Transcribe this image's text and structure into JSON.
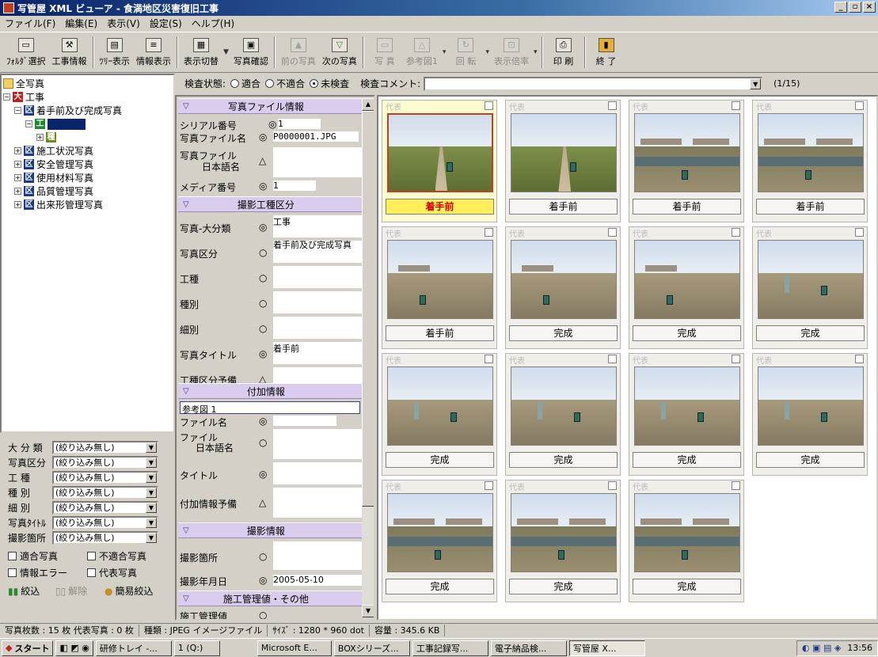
{
  "window": {
    "title": "写管屋 XML ビューア - 食満地区災害復旧工事",
    "min": "_",
    "max": "▫",
    "close": "×"
  },
  "menu": [
    "ファイル(F)",
    "編集(E)",
    "表示(V)",
    "設定(S)",
    "ヘルプ(H)"
  ],
  "toolbar": {
    "folder": "ﾌｫﾙﾀﾞ選択",
    "project": "工事情報",
    "tree": "ﾂﾘｰ表示",
    "info": "情報表示",
    "switch": "表示切替",
    "confirm": "写真確認",
    "prev": "前の写真",
    "next": "次の写真",
    "photo": "写 真",
    "ref": "参考図1",
    "rotate": "回 転",
    "zoom": "表示倍率",
    "print": "印 刷",
    "exit": "終 了"
  },
  "tree": {
    "root": "全写真",
    "project": "工事",
    "section1": "着手前及び完成写真",
    "section1_sub": "工",
    "items": [
      "施工状況写真",
      "安全管理写真",
      "使用材料写真",
      "品質管理写真",
      "出来形管理写真"
    ]
  },
  "filters": {
    "rows": [
      {
        "label": "大 分 類",
        "value": "(絞り込み無し)"
      },
      {
        "label": "写真区分",
        "value": "(絞り込み無し)"
      },
      {
        "label": "工   種",
        "value": "(絞り込み無し)"
      },
      {
        "label": "種   別",
        "value": "(絞り込み無し)"
      },
      {
        "label": "細   別",
        "value": "(絞り込み無し)"
      },
      {
        "label": "写真ﾀｲﾄﾙ",
        "value": "(絞り込み無し)"
      },
      {
        "label": "撮影箇所",
        "value": "(絞り込み無し)"
      }
    ],
    "ok_photo": "適合写真",
    "ng_photo": "不適合写真",
    "info_error": "情報エラー",
    "rep_photo": "代表写真",
    "narrow": "絞込",
    "release": "解除",
    "simple": "簡易絞込"
  },
  "search": {
    "label": "検査状態:",
    "opt1": "適合",
    "opt2": "不適合",
    "opt3": "未検査",
    "comment_label": "検査コメント:",
    "counter": "(1/15)"
  },
  "detail": {
    "sec_file": "写真ファイル情報",
    "serial_label": "シリアル番号",
    "serial_val": "1",
    "file_label": "写真ファイル名",
    "file_val": "P0000001.JPG",
    "jp_label1": "写真ファイル",
    "jp_label2": "日本語名",
    "media_label": "メディア番号",
    "media_val": "1",
    "sec_work": "撮影工種区分",
    "cat_label": "写真-大分類",
    "cat_val": "工事",
    "kubun_label": "写真区分",
    "kubun_val": "着手前及び完成写真",
    "koshu": "工種",
    "shubetsu": "種別",
    "saibetsu": "細別",
    "title_label": "写真タイトル",
    "title_val": "着手前",
    "yobi_label": "工種区分予備",
    "sec_add": "付加情報",
    "ref_fig": "参考図 1",
    "fname_label": "ファイル名",
    "fjp_label1": "ファイル",
    "fjp_label2": "日本語名",
    "ftitle_label": "タイトル",
    "fyobi_label": "付加情報予備",
    "sec_shoot": "撮影情報",
    "place_label": "撮影箇所",
    "date_label": "撮影年月日",
    "date_val": "2005-05-10",
    "sec_mgmt": "施工管理値・その他",
    "mgmt_label": "施工管理値"
  },
  "photos": [
    {
      "header": "代表",
      "caption": "着手前",
      "scene": "path"
    },
    {
      "header": "代表",
      "caption": "着手前",
      "scene": "path"
    },
    {
      "header": "代表",
      "caption": "着手前",
      "scene": "water"
    },
    {
      "header": "代表",
      "caption": "着手前",
      "scene": "water"
    },
    {
      "header": "代表",
      "caption": "着手前",
      "scene": "dry"
    },
    {
      "header": "代表",
      "caption": "完成",
      "scene": "dry"
    },
    {
      "header": "代表",
      "caption": "完成",
      "scene": "dry"
    },
    {
      "header": "代表",
      "caption": "完成",
      "scene": "person"
    },
    {
      "header": "代表",
      "caption": "完成",
      "scene": "person"
    },
    {
      "header": "代表",
      "caption": "完成",
      "scene": "person"
    },
    {
      "header": "代表",
      "caption": "完成",
      "scene": "person"
    },
    {
      "header": "代表",
      "caption": "完成",
      "scene": "person"
    },
    {
      "header": "代表",
      "caption": "完成",
      "scene": "water"
    },
    {
      "header": "代表",
      "caption": "完成",
      "scene": "water"
    },
    {
      "header": "代表",
      "caption": "完成",
      "scene": "water"
    }
  ],
  "status": {
    "count": "写真枚数 : 15 枚 代表写真 : 0 枚",
    "type": "種類 : JPEG イメージファイル",
    "size": "ｻｲｽﾞ : 1280 * 960 dot",
    "volume": "容量 : 345.6 KB"
  },
  "taskbar": {
    "start": "スタート",
    "apps": [
      "研修トレイ -...",
      "1 (Q:)",
      "Microsoft E...",
      "BOXシリーズ...",
      "工事記録写...",
      "電子納品検...",
      "写管屋 X..."
    ],
    "clock": "13:56"
  }
}
